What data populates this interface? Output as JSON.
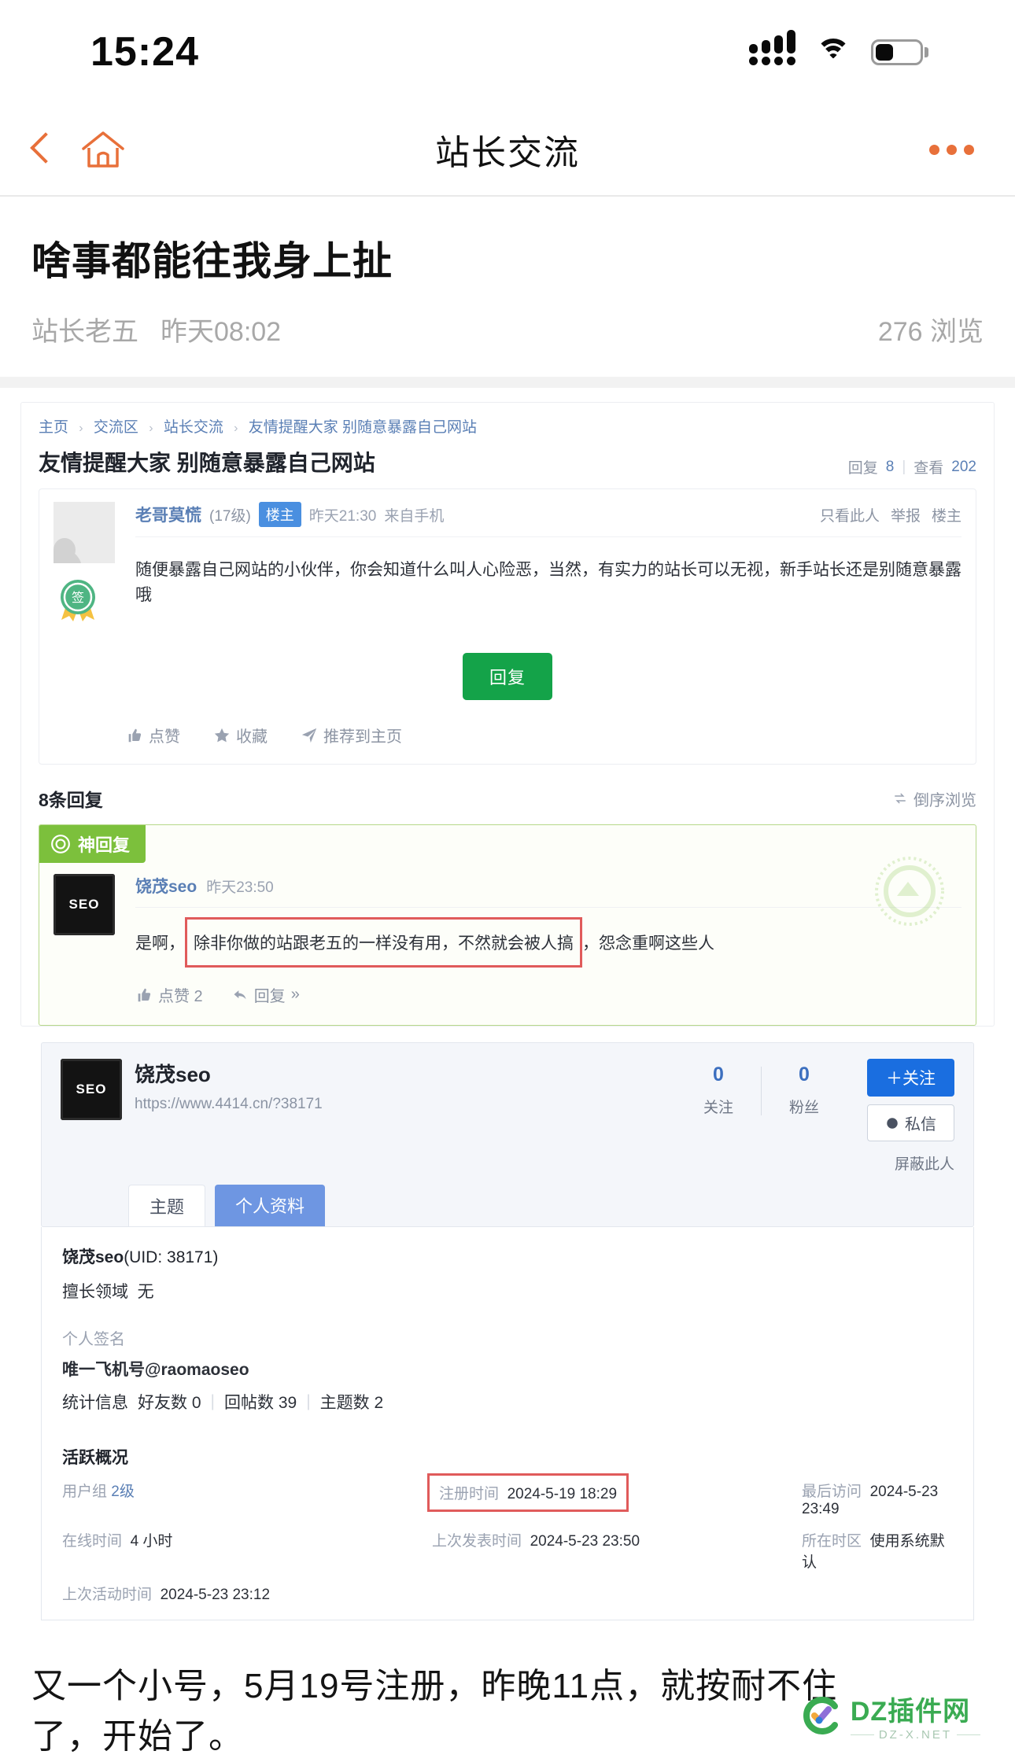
{
  "status_bar": {
    "time": "15:24",
    "signal_icon": "signal-bars-icon",
    "wifi_icon": "wifi-icon",
    "battery_icon": "battery-icon",
    "battery_level_pct": 40
  },
  "nav": {
    "back_icon": "back-chevron-icon",
    "home_icon": "home-icon",
    "title": "站长交流",
    "more_icon": "more-dots-icon",
    "accent_color": "#e8703a"
  },
  "post": {
    "title": "啥事都能往我身上扯",
    "author": "站长老五",
    "time": "昨天08:02",
    "views": "276 浏览"
  },
  "screenshot": {
    "breadcrumb": {
      "items": [
        "主页",
        "交流区",
        "站长交流",
        "友情提醒大家 别随意暴露自己网站"
      ],
      "separator": "›"
    },
    "thread": {
      "title": "友情提醒大家 别随意暴露自己网站",
      "reply_label": "回复",
      "reply_count": "8",
      "view_label": "查看",
      "view_count": "202"
    },
    "first_post": {
      "author": "老哥莫慌",
      "level": "(17级)",
      "tag": "楼主",
      "time": "昨天21:30",
      "source": "来自手机",
      "actions_right": [
        "只看此人",
        "举报",
        "楼主"
      ],
      "content": "随便暴露自己网站的小伙伴，你会知道什么叫人心险恶，当然，有实力的站长可以无视，新手站长还是别随意暴露哦",
      "reply_button": "回复",
      "actions": [
        {
          "icon": "thumbs-up-icon",
          "label": "点赞"
        },
        {
          "icon": "star-icon",
          "label": "收藏"
        },
        {
          "icon": "send-icon",
          "label": "推荐到主页"
        }
      ],
      "medal_icon": "medal-icon"
    },
    "replies_header": {
      "count_label": "8条回复",
      "order_label": "倒序浏览",
      "order_icon": "swap-icon"
    },
    "god_reply": {
      "badge": "神回复",
      "badge_icon": "god-reply-icon",
      "avatar_text": "SEO",
      "author": "饶茂seo",
      "time": "昨天23:50",
      "text_prefix": "是啊，",
      "text_highlighted": "除非你做的站跟老五的一样没有用，不然就会被人搞",
      "text_suffix": "，怨念重啊这些人",
      "like_label": "点赞 2",
      "like_icon": "thumbs-up-icon",
      "reply_label": "回复",
      "reply_icon": "reply-arrow-icon",
      "more_icon": "»",
      "highlight_color": "#e05b5b"
    },
    "profile": {
      "avatar_text": "SEO",
      "name": "饶茂seo",
      "url": "https://www.4414.cn/?38171",
      "counts": [
        {
          "value": "0",
          "label": "关注"
        },
        {
          "value": "0",
          "label": "粉丝"
        }
      ],
      "follow_button": "＋关注",
      "message_button": "私信",
      "message_icon": "message-icon",
      "block_link": "屏蔽此人",
      "tabs": [
        {
          "label": "主题",
          "active": false
        },
        {
          "label": "个人资料",
          "active": true
        }
      ],
      "uid_line_name": "饶茂seo",
      "uid_line_rest": "(UID: 38171)",
      "field_expertise_key": "擅长领域",
      "field_expertise_value": "无",
      "signature_label": "个人签名",
      "signature_value": "唯一飞机号@raomaoseo",
      "stats_label": "统计信息",
      "stats": [
        "好友数 0",
        "回帖数 39",
        "主题数 2"
      ],
      "activity_title": "活跃概况",
      "activity": [
        {
          "key": "用户组",
          "value": "2级",
          "highlight": false,
          "link": true
        },
        {
          "key": "注册时间",
          "value": "2024-5-19 18:29",
          "highlight": true,
          "link": false
        },
        {
          "key": "最后访问",
          "value": "2024-5-23 23:49",
          "highlight": false,
          "link": false
        },
        {
          "key": "在线时间",
          "value": "4 小时",
          "highlight": false,
          "link": false
        },
        {
          "key": "上次发表时间",
          "value": "2024-5-23 23:50",
          "highlight": false,
          "link": false
        },
        {
          "key": "所在时区",
          "value": "使用系统默认",
          "highlight": false,
          "link": false
        },
        {
          "key": "上次活动时间",
          "value": "2024-5-23 23:12",
          "highlight": false,
          "link": false
        }
      ]
    }
  },
  "commentary": {
    "line1": "又一个小号，5月19号注册，昨晚11点，就按耐不住",
    "line2": "了，开始了。"
  },
  "watermark": {
    "logo_icon": "dz-check-logo-icon",
    "main": "DZ插件网",
    "sub": "DZ-X.NET",
    "color": "#3aab52"
  }
}
